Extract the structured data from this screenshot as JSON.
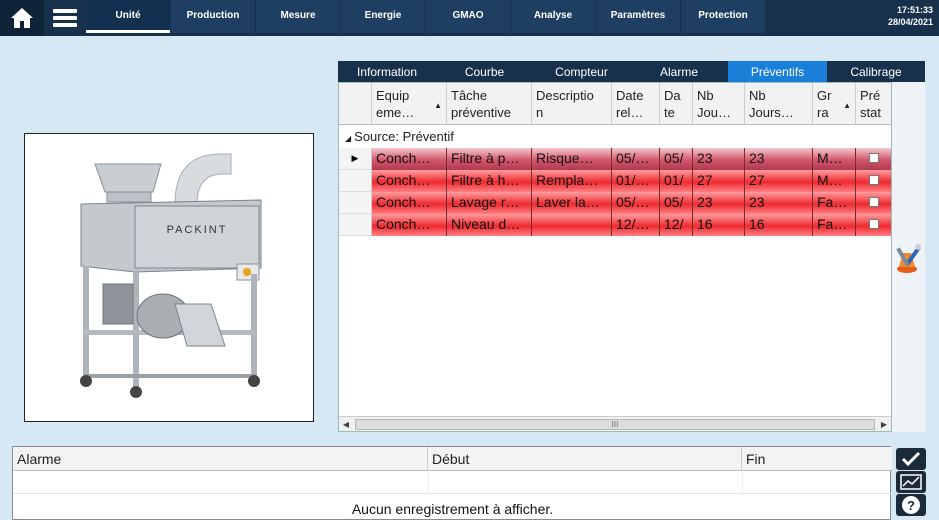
{
  "nav": {
    "tabs": [
      {
        "label": "Unité",
        "active": true
      },
      {
        "label": "Production",
        "active": false
      },
      {
        "label": "Mesure",
        "active": false
      },
      {
        "label": "Energie",
        "active": false
      },
      {
        "label": "GMAO",
        "active": false
      },
      {
        "label": "Analyse",
        "active": false
      },
      {
        "label": "Paramètres",
        "active": false
      },
      {
        "label": "Protection",
        "active": false
      }
    ],
    "time": "17:51:33",
    "date": "28/04/2021"
  },
  "machine_image": {
    "brand_text": "PACKINT"
  },
  "subtabs": [
    {
      "label": "Information",
      "active": false
    },
    {
      "label": "Courbe",
      "active": false
    },
    {
      "label": "Compteur",
      "active": false
    },
    {
      "label": "Alarme",
      "active": false
    },
    {
      "label": "Préventifs",
      "active": true
    },
    {
      "label": "Calibrage",
      "active": false
    }
  ],
  "grid": {
    "columns": [
      {
        "l1": "Equip",
        "l2": "eme…",
        "sort": "up"
      },
      {
        "l1": "Tâche",
        "l2": "préventive",
        "sort": ""
      },
      {
        "l1": "Descriptio",
        "l2": "n",
        "sort": ""
      },
      {
        "l1": "Date",
        "l2": "rel…",
        "sort": ""
      },
      {
        "l1": "Da",
        "l2": "te",
        "sort": ""
      },
      {
        "l1": "Nb",
        "l2": "Jou…",
        "sort": ""
      },
      {
        "l1": "Nb",
        "l2": "Jours…",
        "sort": ""
      },
      {
        "l1": "Gr",
        "l2": "ra",
        "sort": "up"
      },
      {
        "l1": "Pré",
        "l2": "stat",
        "sort": ""
      }
    ],
    "group_label": "Source: Préventif",
    "rows": [
      {
        "cells": [
          "Conch…",
          "Filtre à p…",
          "Risque…",
          "05/…",
          "05/",
          "23",
          "23",
          "M…"
        ],
        "current": true
      },
      {
        "cells": [
          "Conch…",
          "Filtre à h…",
          "Rempla…",
          "01/…",
          "01/",
          "27",
          "27",
          "M…"
        ],
        "current": false
      },
      {
        "cells": [
          "Conch…",
          "Lavage r…",
          "Laver la…",
          "05/…",
          "05/",
          "23",
          "23",
          "Fa…"
        ],
        "current": false
      },
      {
        "cells": [
          "Conch…",
          "Niveau d…",
          "",
          "12/…",
          "12/",
          "16",
          "16",
          "Fa…"
        ],
        "current": false
      }
    ],
    "scroll_thumb": "III"
  },
  "alarms": {
    "columns": [
      "Alarme",
      "Début",
      "Fin"
    ],
    "empty_text": "Aucun enregistrement à afficher."
  },
  "icons": {
    "home": "home-icon",
    "menu": "hamburger-menu-icon",
    "tools": "tools-icon",
    "acknowledge": "checkmark-icon",
    "chart": "chart-icon",
    "help": "help-icon"
  },
  "colors": {
    "nav_bg": "#17314d",
    "active_subtab": "#1a7fd8",
    "alarm_row_red": "#ee2a2f",
    "background": "#d6e8f4"
  }
}
